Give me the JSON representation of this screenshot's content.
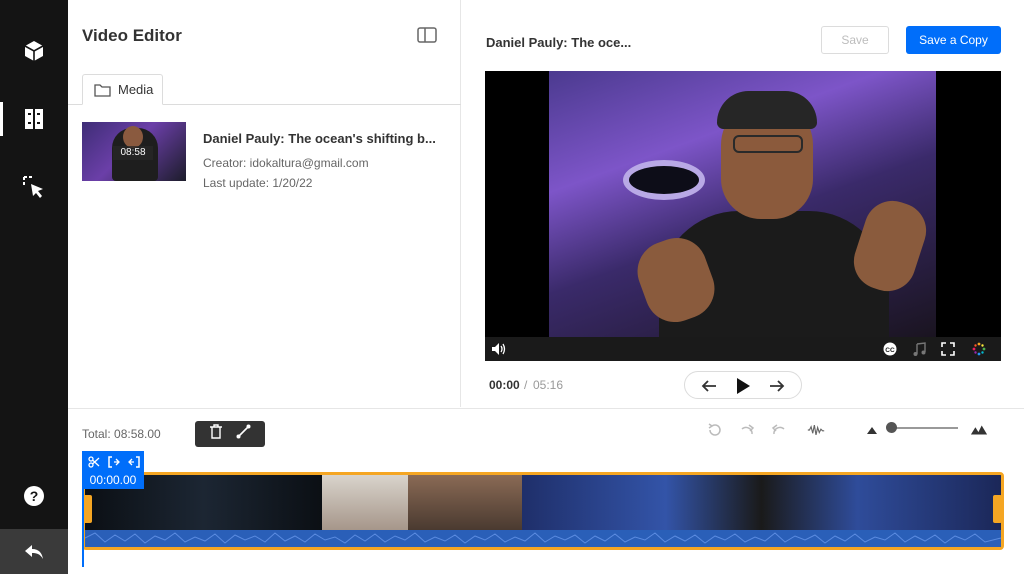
{
  "colors": {
    "accent": "#006efa",
    "rail": "#141414",
    "track_border": "#f5a623",
    "wave": "#2a5fb8"
  },
  "rail": {
    "items": [
      {
        "name": "cube-icon"
      },
      {
        "name": "book-icon",
        "active": true
      },
      {
        "name": "select-cursor-icon"
      }
    ],
    "help_icon": "help-icon",
    "back_icon": "undo-back-icon"
  },
  "media_panel": {
    "title": "Video Editor",
    "tab_label": "Media",
    "entry": {
      "name": "Daniel Pauly: The ocean's shifting b...",
      "duration": "08:58",
      "creator": "Creator: idokaltura@gmail.com",
      "updated": "Last update: 1/20/22"
    }
  },
  "player": {
    "title": "Daniel Pauly: The oce...",
    "save_label": "Save",
    "save_copy_label": "Save a Copy",
    "time_current": "00:00",
    "time_separator": "/",
    "time_total": "05:16"
  },
  "timeline": {
    "total_label": "Total: 08:58.00",
    "playhead_time": "00:00.00"
  }
}
